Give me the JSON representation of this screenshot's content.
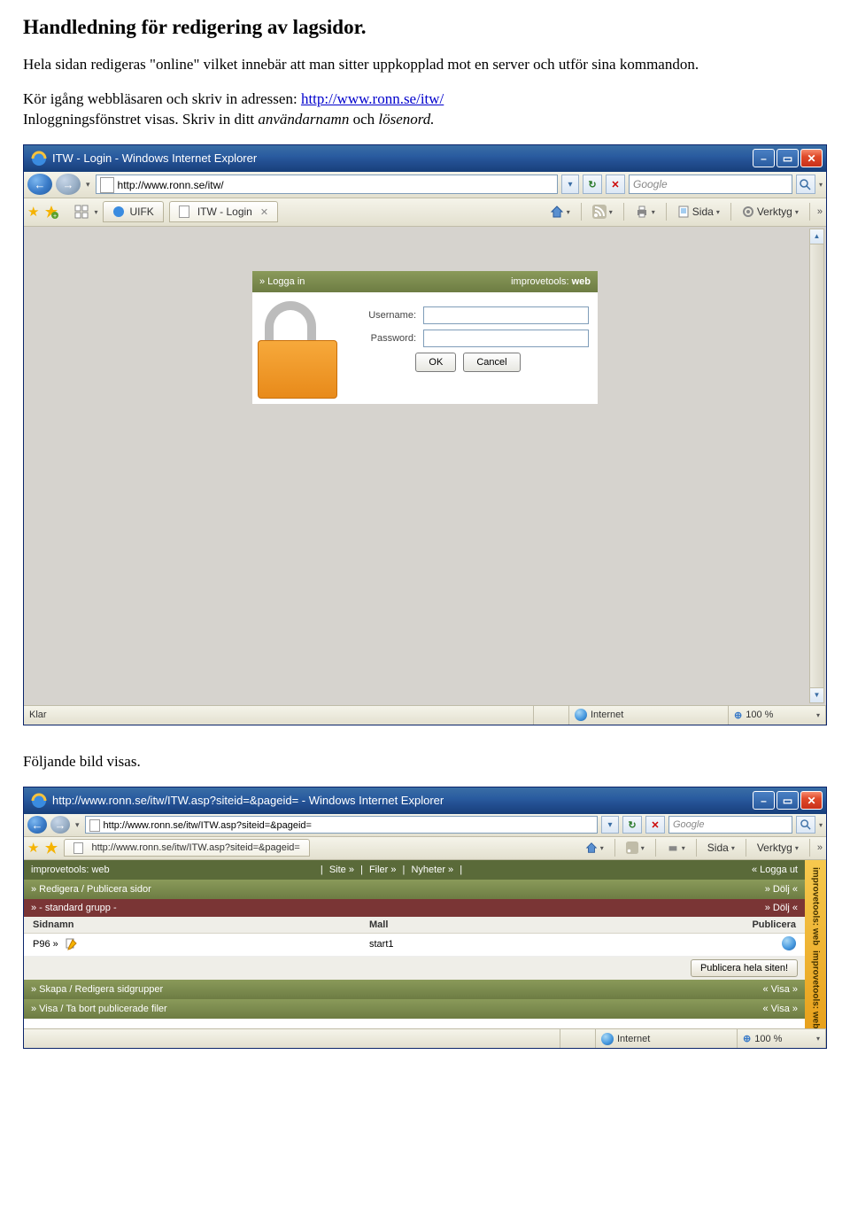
{
  "doc": {
    "title": "Handledning för redigering av lagsidor.",
    "p1": "Hela sidan redigeras \"online\" vilket innebär att man sitter uppkopplad mot en server och utför sina kommandon.",
    "p2a": "Kör igång webbläsaren och skriv in adressen: ",
    "p2link": "http://www.ronn.se/itw/",
    "p2b": "Inloggningsfönstret visas. Skriv in ditt ",
    "p2i1": "användarnamn",
    "p2mid": " och ",
    "p2i2": "lösenord.",
    "p3": "Följande bild visas."
  },
  "win1": {
    "title": "ITW - Login - Windows Internet Explorer",
    "url": "http://www.ronn.se/itw/",
    "search_placeholder": "Google",
    "fav_tab": "UIFK",
    "active_tab": "ITW - Login",
    "tool_home": "",
    "tool_sida": "Sida",
    "tool_verktyg": "Verktyg",
    "login": {
      "hdr_left": "» Logga in",
      "hdr_brand": "improvetools:",
      "hdr_brand_b": "web",
      "username": "Username:",
      "password": "Password:",
      "ok": "OK",
      "cancel": "Cancel"
    },
    "status_left": "Klar",
    "status_zone": "Internet",
    "status_zoom": "100 %"
  },
  "win2": {
    "title": "http://www.ronn.se/itw/ITW.asp?siteid=&pageid= - Windows Internet Explorer",
    "url": "http://www.ronn.se/itw/ITW.asp?siteid=&pageid=",
    "search_placeholder": "Google",
    "active_tab": "http://www.ronn.se/itw/ITW.asp?siteid=&pageid=",
    "tool_sida": "Sida",
    "tool_verktyg": "Verktyg",
    "admin": {
      "topbrand": "improvetools: web",
      "menus": [
        "Site »",
        "Filer »",
        "Nyheter »"
      ],
      "logout": "« Logga ut",
      "sect1_l": "» Redigera / Publicera sidor",
      "sect1_r": "» Dölj «",
      "sub_l": "» - standard grupp -",
      "sub_r": "» Dölj «",
      "th1": "Sidnamn",
      "th2": "Mall",
      "th3": "Publicera",
      "row": {
        "name": "P96 »",
        "mall": "start1"
      },
      "pub_btn": "Publicera hela siten!",
      "sect2_l": "» Skapa / Redigera sidgrupper",
      "sect2_r": "« Visa »",
      "sect3_l": "» Visa / Ta bort publicerade filer",
      "sect3_r": "« Visa »",
      "side1": "improvetools: web",
      "side2": "improvetools: web"
    },
    "status_zone": "Internet",
    "status_zoom": "100 %"
  }
}
